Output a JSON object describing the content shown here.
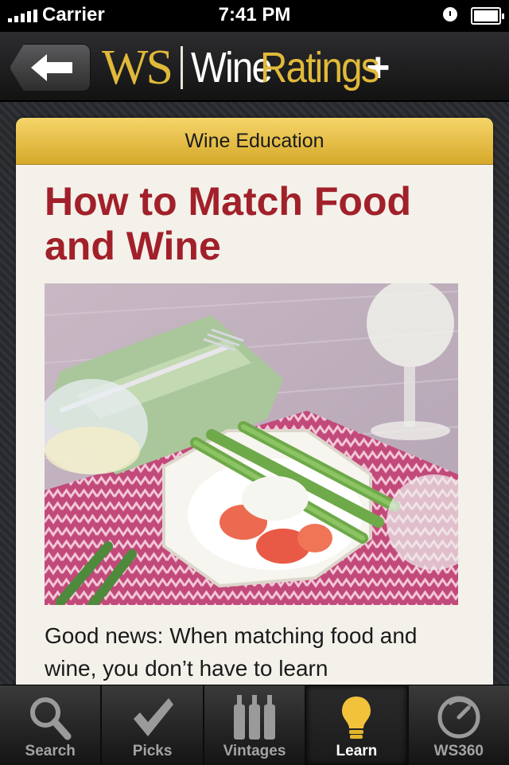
{
  "status": {
    "carrier": "Carrier",
    "time": "7:41 PM"
  },
  "navbar": {
    "brand_ws": "WS",
    "brand_wine": "Wine",
    "brand_ratings": "Ratings",
    "brand_plus": "+"
  },
  "article": {
    "section": "Wine Education",
    "title": "How to Match Food and Wine",
    "body": "Good news: When matching food and wine, you don’t have to learn"
  },
  "tabs": [
    {
      "label": "Search",
      "icon": "search-icon"
    },
    {
      "label": "Picks",
      "icon": "checkmark-icon"
    },
    {
      "label": "Vintages",
      "icon": "bottles-icon"
    },
    {
      "label": "Learn",
      "icon": "lightbulb-icon",
      "active": true
    },
    {
      "label": "WS360",
      "icon": "gauge-icon"
    }
  ],
  "colors": {
    "accent_gold": "#e1b93a",
    "title_red": "#a1202a"
  }
}
